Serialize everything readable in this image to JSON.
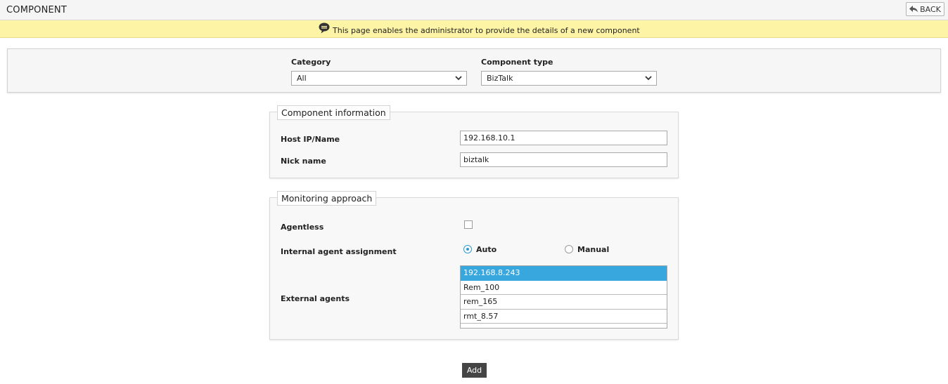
{
  "header": {
    "title": "COMPONENT",
    "back_label": "BACK"
  },
  "info": {
    "message": "This page enables the administrator to provide the details of a new component"
  },
  "filters": {
    "category_label": "Category",
    "category_value": "All",
    "component_type_label": "Component type",
    "component_type_value": "BizTalk"
  },
  "component_info": {
    "legend": "Component information",
    "host_label": "Host IP/Name",
    "host_value": "192.168.10.1",
    "nick_label": "Nick name",
    "nick_value": "biztalk"
  },
  "monitoring": {
    "legend": "Monitoring approach",
    "agentless_label": "Agentless",
    "agentless_checked": false,
    "internal_label": "Internal agent assignment",
    "auto_label": "Auto",
    "manual_label": "Manual",
    "selected_assignment": "Auto",
    "external_label": "External agents",
    "external_agents": [
      "192.168.8.243",
      "Rem_100",
      "rem_165",
      "rmt_8.57"
    ],
    "selected_agent": "192.168.8.243"
  },
  "actions": {
    "add_label": "Add"
  },
  "colors": {
    "info_bar": "#fdf5a5",
    "selected_item": "#38a7de",
    "add_button": "#454545"
  }
}
